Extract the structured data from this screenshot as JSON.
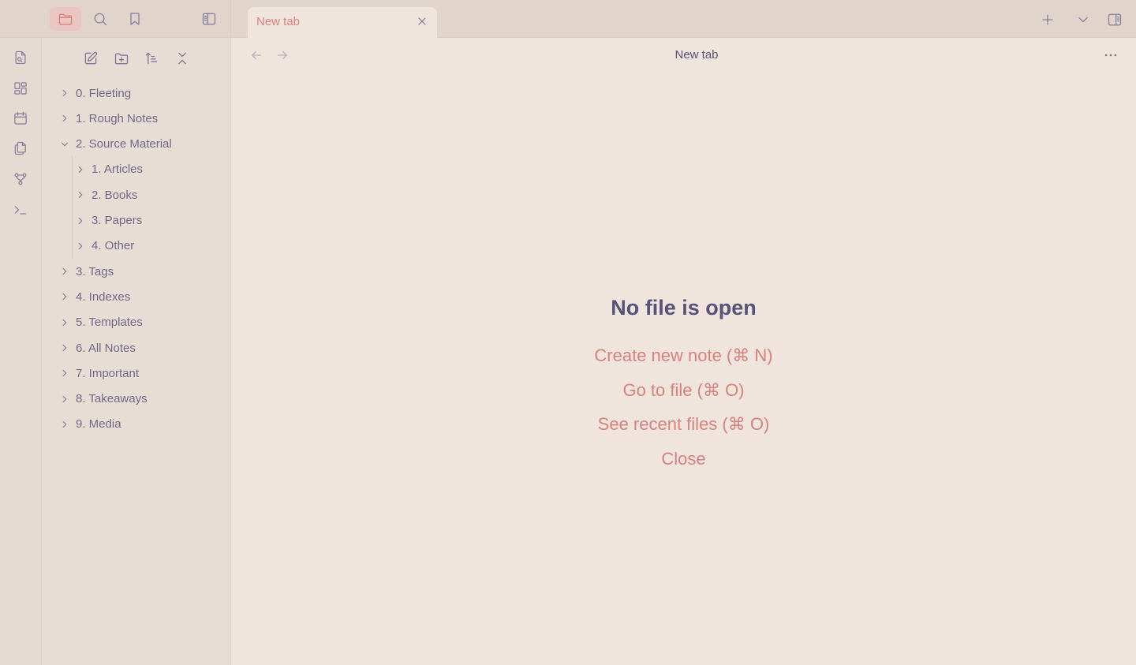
{
  "toolbar": {
    "left_icons": [
      "folder-icon",
      "search-icon",
      "bookmark-icon",
      "sidebar-toggle-icon"
    ],
    "right_icons": [
      "plus-icon",
      "chevron-down-icon",
      "right-sidebar-icon"
    ]
  },
  "tab": {
    "title": "New tab",
    "close_icon": "close-icon"
  },
  "ribbon": {
    "icons": [
      "open-quick-switcher-icon",
      "dashboard-icon",
      "calendar-icon",
      "copy-icon",
      "graph-icon",
      "terminal-icon"
    ]
  },
  "sidebar": {
    "tools": [
      "new-note-icon",
      "new-folder-icon",
      "sort-icon",
      "collapse-all-icon"
    ],
    "tree": [
      {
        "label": "0. Fleeting",
        "expanded": false,
        "level": 0
      },
      {
        "label": "1. Rough Notes",
        "expanded": false,
        "level": 0
      },
      {
        "label": "2. Source Material",
        "expanded": true,
        "level": 0
      },
      {
        "label": "1. Articles",
        "expanded": false,
        "level": 1
      },
      {
        "label": "2. Books",
        "expanded": false,
        "level": 1
      },
      {
        "label": "3. Papers",
        "expanded": false,
        "level": 1
      },
      {
        "label": "4. Other",
        "expanded": false,
        "level": 1
      },
      {
        "label": "3. Tags",
        "expanded": false,
        "level": 0
      },
      {
        "label": "4. Indexes",
        "expanded": false,
        "level": 0
      },
      {
        "label": "5. Templates",
        "expanded": false,
        "level": 0
      },
      {
        "label": "6. All Notes",
        "expanded": false,
        "level": 0
      },
      {
        "label": "7. Important",
        "expanded": false,
        "level": 0
      },
      {
        "label": "8. Takeaways",
        "expanded": false,
        "level": 0
      },
      {
        "label": "9. Media",
        "expanded": false,
        "level": 0
      }
    ]
  },
  "main": {
    "title": "New tab",
    "empty": {
      "heading": "No file is open",
      "actions": [
        "Create new note (⌘ N)",
        "Go to file (⌘ O)",
        "See recent files (⌘ O)",
        "Close"
      ]
    }
  },
  "colors": {
    "accent": "#d7827e",
    "text": "#575279",
    "background": "#efe5dc",
    "sidebar": "#e8ddd4",
    "topbar": "#e1d4ca"
  }
}
